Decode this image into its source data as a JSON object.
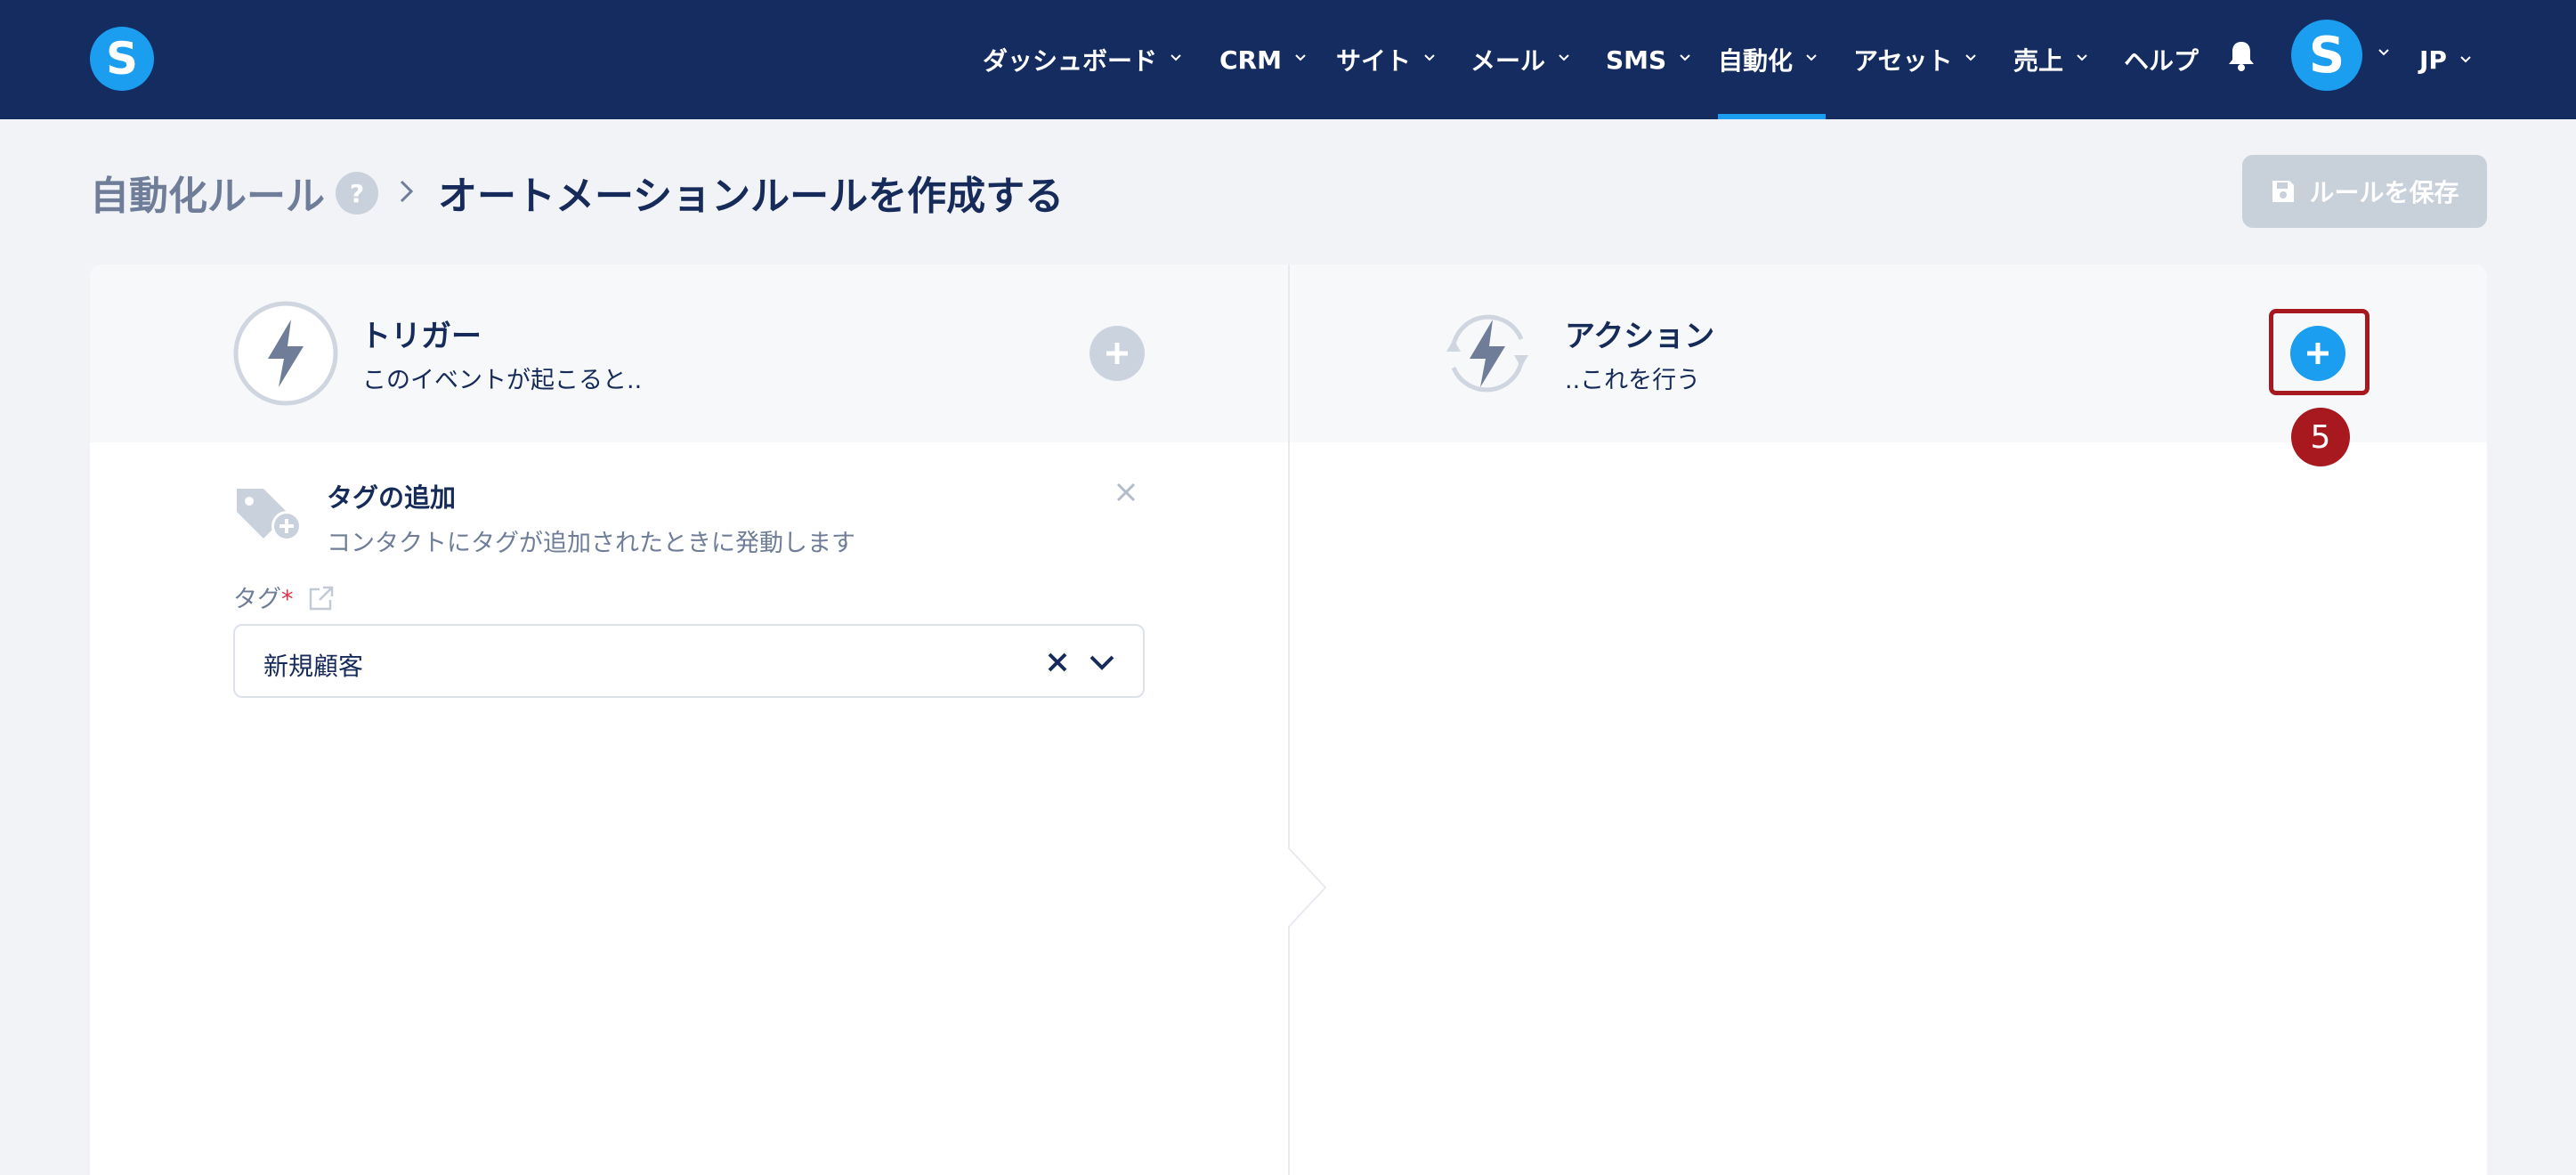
{
  "nav": {
    "items": [
      {
        "label": "ダッシュボード"
      },
      {
        "label": "CRM"
      },
      {
        "label": "サイト"
      },
      {
        "label": "メール"
      },
      {
        "label": "SMS"
      },
      {
        "label": "自動化",
        "active": true
      },
      {
        "label": "アセット"
      },
      {
        "label": "売上"
      },
      {
        "label": "ヘルプ"
      }
    ],
    "logo_letter": "S",
    "avatar_letter": "S",
    "language": "JP"
  },
  "header": {
    "breadcrumb_root": "自動化ルール",
    "help_badge": "?",
    "page_title": "オートメーションルールを作成する",
    "save_label": "ルールを保存"
  },
  "trigger_panel": {
    "title": "トリガー",
    "subtitle": "このイベントが起こると.."
  },
  "action_panel": {
    "title": "アクション",
    "subtitle": "..これを行う"
  },
  "trigger_item": {
    "title": "タグの追加",
    "description": "コンタクトにタグが追加されたときに発動します",
    "field_label": "タグ",
    "required_mark": "*",
    "selected_value": "新規顧客"
  },
  "annotation": {
    "step_number": "5"
  },
  "colors": {
    "nav_bg": "#152c61",
    "accent": "#1b9df0",
    "highlight": "#a8181f"
  }
}
